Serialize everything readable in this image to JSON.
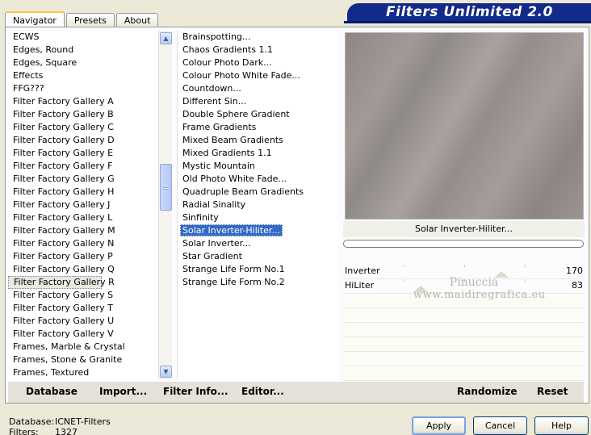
{
  "header": {
    "title": "Filters Unlimited 2.0"
  },
  "tabs": [
    {
      "label": "Navigator",
      "active": true
    },
    {
      "label": "Presets",
      "active": false
    },
    {
      "label": "About",
      "active": false
    }
  ],
  "categories": {
    "items": [
      "ECWS",
      "Edges, Round",
      "Edges, Square",
      "Effects",
      "FFG???",
      "Filter Factory Gallery A",
      "Filter Factory Gallery B",
      "Filter Factory Gallery C",
      "Filter Factory Gallery D",
      "Filter Factory Gallery E",
      "Filter Factory Gallery F",
      "Filter Factory Gallery G",
      "Filter Factory Gallery H",
      "Filter Factory Gallery J",
      "Filter Factory Gallery L",
      "Filter Factory Gallery M",
      "Filter Factory Gallery N",
      "Filter Factory Gallery P",
      "Filter Factory Gallery Q",
      "Filter Factory Gallery R",
      "Filter Factory Gallery S",
      "Filter Factory Gallery T",
      "Filter Factory Gallery U",
      "Filter Factory Gallery V",
      "Frames, Marble & Crystal",
      "Frames, Stone & Granite",
      "Frames, Textured"
    ],
    "selected": "Filter Factory Gallery R"
  },
  "filters": {
    "items": [
      "Brainspotting...",
      "Chaos Gradients 1.1",
      "Colour Photo Dark...",
      "Colour Photo White Fade...",
      "Countdown...",
      "Different Sin...",
      "Double Sphere Gradient",
      "Frame Gradients",
      "Mixed Beam Gradients",
      "Mixed Gradients 1.1",
      "Mystic Mountain",
      "Old Photo White Fade...",
      "Quadruple Beam Gradients",
      "Radial Sinality",
      "Sinfinity",
      "Solar Inverter-Hiliter...",
      "Solar Inverter...",
      "Star Gradient",
      "Strange Life Form No.1",
      "Strange Life Form No.2"
    ],
    "selected": "Solar Inverter-Hiliter..."
  },
  "preview": {
    "filter_name": "Solar Inverter-Hiliter..."
  },
  "sliders": [
    {
      "label": "Inverter",
      "value": "170"
    },
    {
      "label": "HiLiter",
      "value": "83"
    }
  ],
  "watermark": {
    "line1": "Pinuccia",
    "line2": "www.maidiregrafica.eu"
  },
  "toolbar": {
    "database": "Database",
    "import": "Import...",
    "filter_info": "Filter Info...",
    "editor": "Editor...",
    "randomize": "Randomize",
    "reset": "Reset"
  },
  "status": {
    "database_label": "Database:",
    "database_value": "ICNET-Filters",
    "filters_label": "Filters:",
    "filters_value": "1327"
  },
  "buttons": {
    "apply": "Apply",
    "cancel": "Cancel",
    "help": "Help"
  },
  "colors": {
    "banner": "#142a8a",
    "selection": "#316ac5"
  }
}
